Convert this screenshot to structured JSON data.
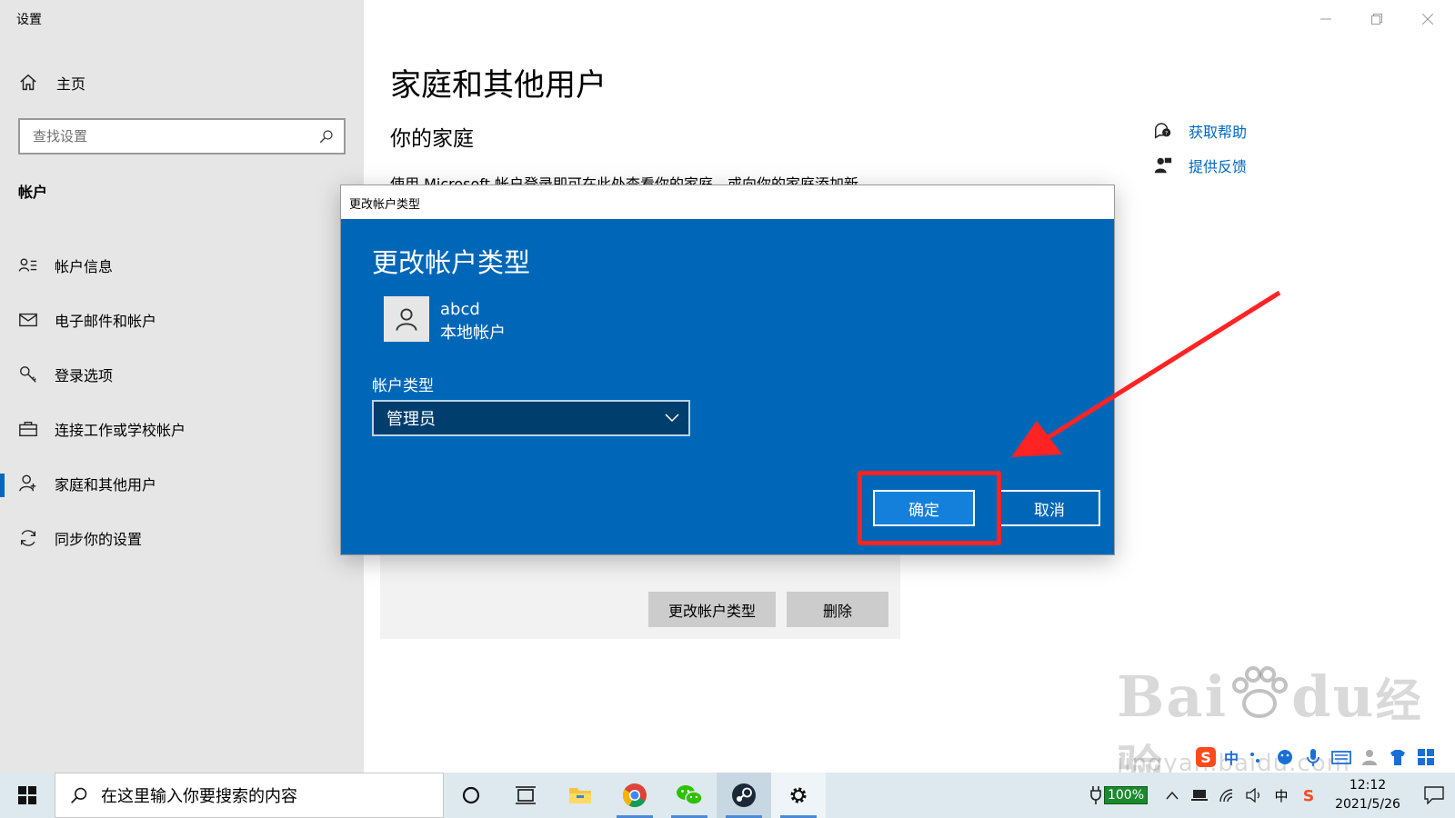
{
  "app": {
    "title": "设置"
  },
  "sidebar": {
    "home_label": "主页",
    "search_placeholder": "查找设置",
    "section": "帐户",
    "items": [
      {
        "label": "帐户信息",
        "icon": "account-info-icon"
      },
      {
        "label": "电子邮件和帐户",
        "icon": "mail-icon"
      },
      {
        "label": "登录选项",
        "icon": "key-icon"
      },
      {
        "label": "连接工作或学校帐户",
        "icon": "briefcase-icon"
      },
      {
        "label": "家庭和其他用户",
        "icon": "person-icon",
        "active": true
      },
      {
        "label": "同步你的设置",
        "icon": "sync-icon"
      }
    ]
  },
  "main": {
    "title": "家庭和其他用户",
    "subtitle": "你的家庭",
    "description": "使用 Microsoft 帐户登录即可在此处查看你的家庭，或向你的家庭添加新",
    "help": {
      "get_help": "获取帮助",
      "feedback": "提供反馈"
    },
    "card_buttons": {
      "change_type": "更改帐户类型",
      "delete": "删除"
    }
  },
  "dialog": {
    "window_title": "更改帐户类型",
    "heading": "更改帐户类型",
    "user_name": "abcd",
    "user_type": "本地帐户",
    "account_type_label": "帐户类型",
    "account_type_value": "管理员",
    "ok": "确定",
    "cancel": "取消"
  },
  "taskbar": {
    "search_placeholder": "在这里输入你要搜索的内容",
    "battery": "100%",
    "ime_lang": "中",
    "time": "12:12",
    "date": "2021/5/26"
  },
  "watermark": {
    "brand": "Bai",
    "brand_end": "du",
    "suffix": "经验",
    "url": "jingyan.baidu.com"
  },
  "colors": {
    "accent": "#0067c0",
    "dialog_bg": "#0067b8",
    "highlight": "#ff2323",
    "sidebar_bg": "#e6e6e6",
    "taskbar_bg": "#dde9ef"
  }
}
